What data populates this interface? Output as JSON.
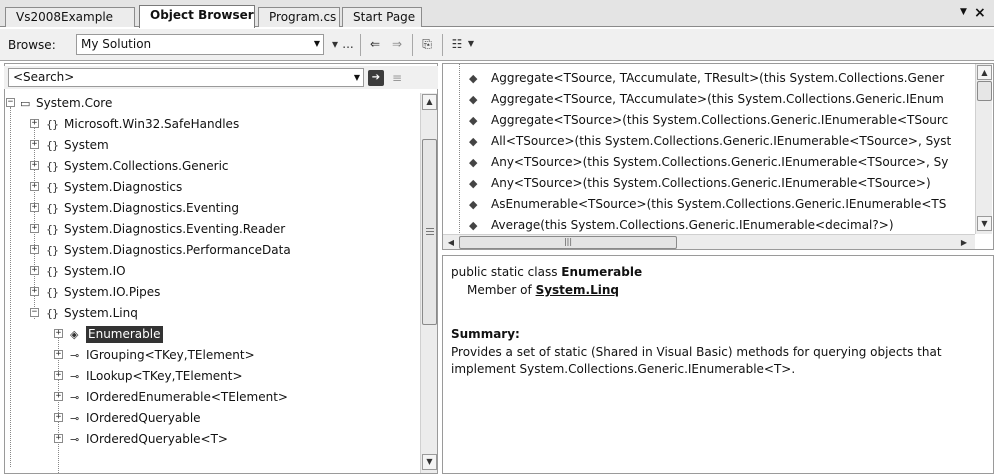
{
  "tabs": [
    {
      "label": "Vs2008Example",
      "active": false
    },
    {
      "label": "Object Browser",
      "active": true
    },
    {
      "label": "Program.cs",
      "active": false
    },
    {
      "label": "Start Page",
      "active": false
    }
  ],
  "toolbar": {
    "browse_label": "Browse:",
    "browse_value": "My Solution",
    "ellipsis": "..."
  },
  "search": {
    "placeholder": "<Search>"
  },
  "tree": {
    "root": "System.Core",
    "namespaces": [
      "Microsoft.Win32.SafeHandles",
      "System",
      "System.Collections.Generic",
      "System.Diagnostics",
      "System.Diagnostics.Eventing",
      "System.Diagnostics.Eventing.Reader",
      "System.Diagnostics.PerformanceData",
      "System.IO",
      "System.IO.Pipes",
      "System.Linq"
    ],
    "linq_children": [
      "Enumerable",
      "IGrouping<TKey,TElement>",
      "ILookup<TKey,TElement>",
      "IOrderedEnumerable<TElement>",
      "IOrderedQueryable",
      "IOrderedQueryable<T>"
    ],
    "ns_icon": "{}",
    "selected": "Enumerable"
  },
  "members": [
    "Aggregate<TSource, TAccumulate, TResult>(this System.Collections.Gener",
    "Aggregate<TSource, TAccumulate>(this System.Collections.Generic.IEnum",
    "Aggregate<TSource>(this System.Collections.Generic.IEnumerable<TSourc",
    "All<TSource>(this System.Collections.Generic.IEnumerable<TSource>, Syst",
    "Any<TSource>(this System.Collections.Generic.IEnumerable<TSource>, Sy",
    "Any<TSource>(this System.Collections.Generic.IEnumerable<TSource>)",
    "AsEnumerable<TSource>(this System.Collections.Generic.IEnumerable<TS",
    "Average(this System.Collections.Generic.IEnumerable<decimal?>)"
  ],
  "description": {
    "signature_prefix": "public static class ",
    "signature_name": "Enumerable",
    "member_of_prefix": "Member of ",
    "member_of_link": "System.Linq",
    "summary_label": "Summary:",
    "summary_text": "Provides a set of static (Shared in Visual Basic) methods for querying objects that implement System.Collections.Generic.IEnumerable<T>."
  },
  "icons": {
    "method": "extension-method-icon",
    "interface": "interface-icon",
    "class": "class-icon",
    "assembly": "assembly-icon",
    "namespace": "namespace-icon"
  }
}
